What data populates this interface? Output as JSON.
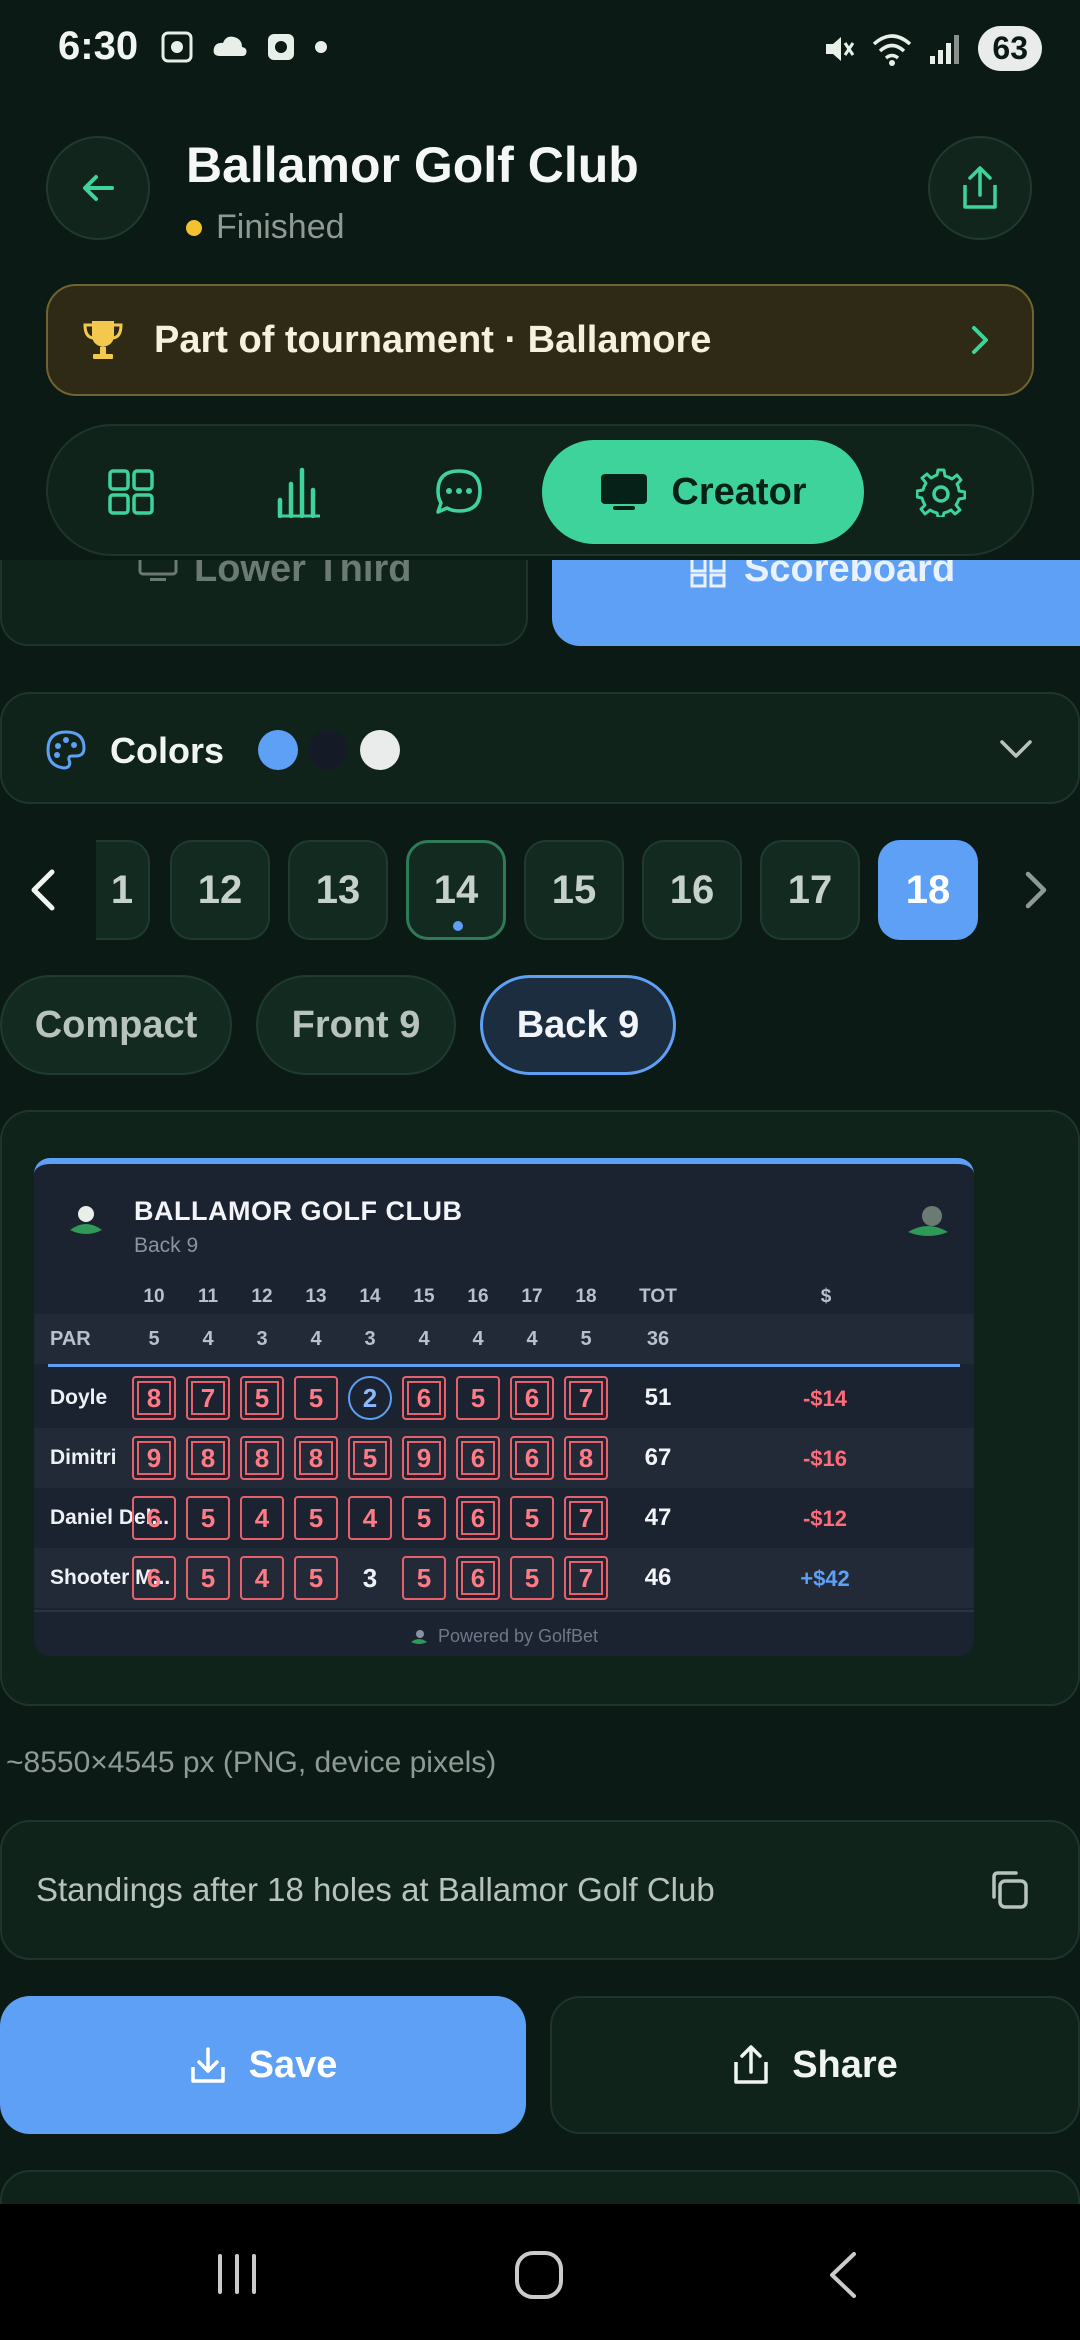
{
  "status": {
    "time": "6:30",
    "battery": "63"
  },
  "header": {
    "title": "Ballamor Golf Club",
    "status": "Finished"
  },
  "tournament": {
    "label": "Part of tournament · Ballamore"
  },
  "tabs": {
    "creator_label": "Creator"
  },
  "segments": {
    "lower_third": "Lower Third",
    "scoreboard": "Scoreboard"
  },
  "colors": {
    "label": "Colors",
    "swatches": [
      "#5ea0f5",
      "#141a26",
      "#e9ecea"
    ]
  },
  "holes": [
    "1",
    "12",
    "13",
    "14",
    "15",
    "16",
    "17",
    "18"
  ],
  "views": {
    "compact": "Compact",
    "front9": "Front 9",
    "back9": "Back 9"
  },
  "scorecard": {
    "title": "BALLAMOR GOLF CLUB",
    "subtitle": "Back 9",
    "columns": [
      "10",
      "11",
      "12",
      "13",
      "14",
      "15",
      "16",
      "17",
      "18",
      "TOT",
      "$"
    ],
    "par_label": "PAR",
    "par": [
      "5",
      "4",
      "3",
      "4",
      "3",
      "4",
      "4",
      "4",
      "5",
      "36"
    ],
    "players": [
      {
        "name": "Doyle",
        "scores": [
          "8",
          "7",
          "5",
          "5",
          "2",
          "6",
          "5",
          "6",
          "7"
        ],
        "total": "51",
        "money": "-$14"
      },
      {
        "name": "Dimitri",
        "scores": [
          "9",
          "8",
          "8",
          "8",
          "5",
          "9",
          "6",
          "6",
          "8"
        ],
        "total": "67",
        "money": "-$16"
      },
      {
        "name": "Daniel Del...",
        "scores": [
          "6",
          "5",
          "4",
          "5",
          "4",
          "5",
          "6",
          "5",
          "7"
        ],
        "total": "47",
        "money": "-$12"
      },
      {
        "name": "Shooter M...",
        "scores": [
          "6",
          "5",
          "4",
          "5",
          "3",
          "5",
          "6",
          "5",
          "7"
        ],
        "total": "46",
        "money": "+$42"
      }
    ],
    "footer": "Powered by GolfBet"
  },
  "export_note": "~8550×4545 px (PNG, device pixels)",
  "caption": "Standings after 18 holes at Ballamor Golf Club",
  "actions": {
    "save": "Save",
    "share": "Share"
  }
}
